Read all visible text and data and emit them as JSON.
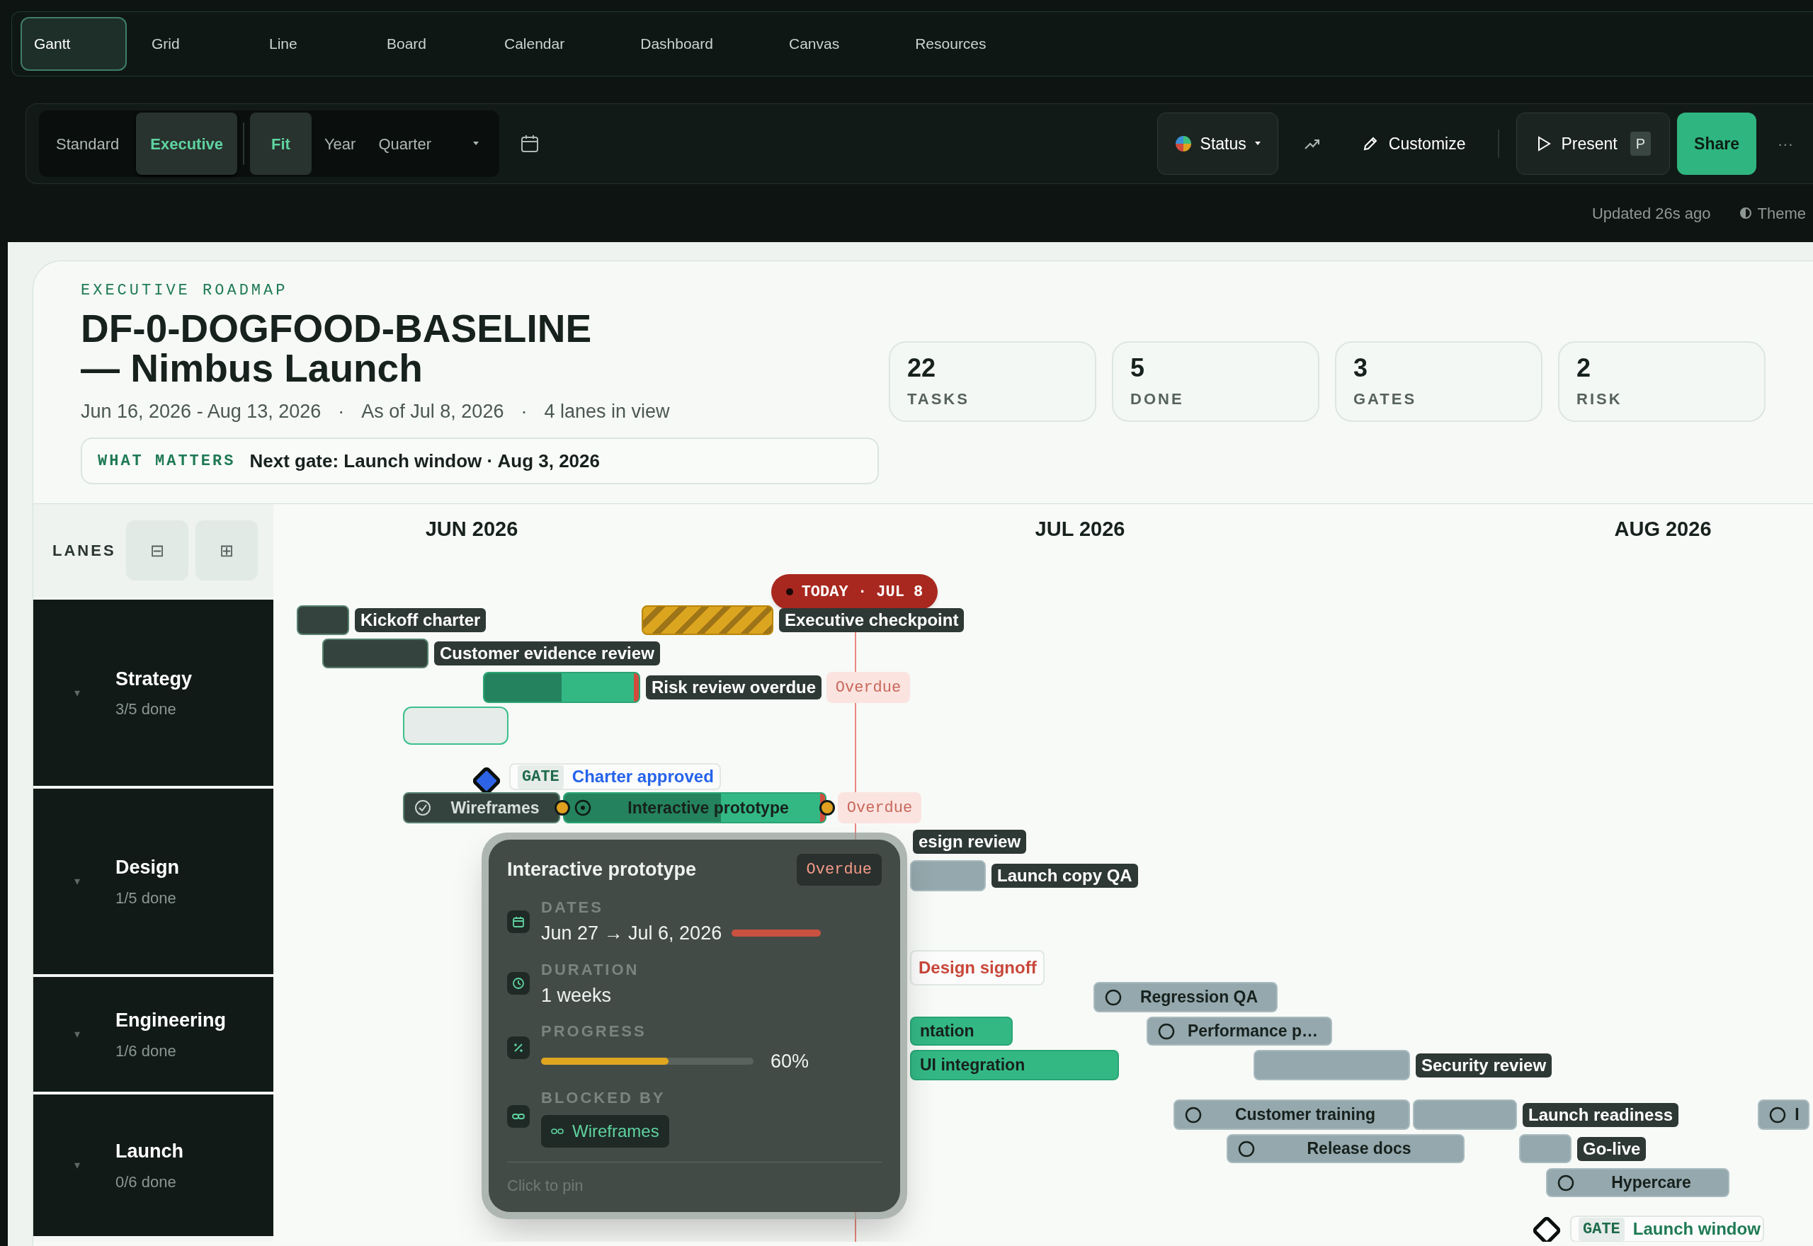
{
  "view_tabs": [
    {
      "label": "Gantt",
      "selected": true
    },
    {
      "label": "Grid",
      "selected": false
    },
    {
      "label": "Line",
      "selected": false
    },
    {
      "label": "Board",
      "selected": false
    },
    {
      "label": "Calendar",
      "selected": false
    },
    {
      "label": "Dashboard",
      "selected": false
    },
    {
      "label": "Canvas",
      "selected": false
    },
    {
      "label": "Resources",
      "selected": false
    }
  ],
  "toolbar": {
    "density": [
      {
        "label": "Standard",
        "selected": false
      },
      {
        "label": "Executive",
        "selected": true
      }
    ],
    "zoom": [
      {
        "label": "Fit",
        "selected": true
      },
      {
        "label": "Year",
        "selected": false
      },
      {
        "label": "Quarter",
        "selected": false
      }
    ],
    "status_button": "Status",
    "customize_button": "Customize",
    "present_button": {
      "label": "Present",
      "shortcut": "P"
    },
    "share_button": "Share",
    "more_button": "···"
  },
  "status_line": {
    "updated": "Updated 26s ago",
    "theme": "Theme"
  },
  "header": {
    "eyebrow": "EXECUTIVE ROADMAP",
    "title_lines": [
      "DF-0-DOGFOOD-BASELINE",
      "— Nimbus Launch"
    ],
    "meta": [
      "Jun 16, 2026 - Aug 13, 2026",
      "As of Jul 8, 2026",
      "4 lanes in view"
    ],
    "meta_separator": "·",
    "what_matters": {
      "label": "WHAT MATTERS",
      "text": "Next gate: Launch window · Aug 3, 2026"
    }
  },
  "stats": [
    {
      "value": "22",
      "label": "TASKS"
    },
    {
      "value": "5",
      "label": "DONE"
    },
    {
      "value": "3",
      "label": "GATES"
    },
    {
      "value": "2",
      "label": "RISK"
    }
  ],
  "lanes_header": {
    "title": "LANES",
    "collapse": "⊟",
    "expand": "⊞"
  },
  "lanes": [
    {
      "name": "Strategy",
      "progress": "3/5 done",
      "chevron": "▾"
    },
    {
      "name": "Design",
      "progress": "1/5 done",
      "chevron": "▾"
    },
    {
      "name": "Engineering",
      "progress": "1/6 done",
      "chevron": "▾"
    },
    {
      "name": "Launch",
      "progress": "0/6 done",
      "chevron": "▾"
    }
  ],
  "months": [
    "JUN 2026",
    "JUL 2026",
    "AUG 2026"
  ],
  "today": {
    "label": "TODAY · JUL 8"
  },
  "bars": [
    {
      "kind": "done",
      "label": "Kickoff charter"
    },
    {
      "kind": "done",
      "label": "Customer evidence review"
    },
    {
      "kind": "hatched",
      "label": "Executive checkpoint"
    },
    {
      "kind": "active",
      "label": "Risk review overdue",
      "level": 0.5,
      "overdue": true,
      "flag": "Overdue"
    },
    {
      "kind": "empty"
    },
    {
      "kind": "gate",
      "tag": "GATE",
      "label": "Charter approved",
      "color": "#2563eb"
    },
    {
      "kind": "done",
      "label": "Wireframes"
    },
    {
      "kind": "active",
      "label": "Interactive prototype",
      "level": 0.6,
      "overdue": true,
      "flag": "Overdue",
      "handles": true
    },
    {
      "kind": "label",
      "label": "esign review"
    },
    {
      "kind": "planned",
      "label": "Launch copy QA"
    },
    {
      "kind": "gate",
      "label": "Design signoff",
      "color": "#c8473a"
    },
    {
      "kind": "active",
      "label": "ntation"
    },
    {
      "kind": "active",
      "label": "UI integration"
    },
    {
      "kind": "planned",
      "label": "Regression QA"
    },
    {
      "kind": "planned",
      "label": "Performance p…"
    },
    {
      "kind": "planned",
      "label": "Security review"
    },
    {
      "kind": "planned",
      "label": "Customer training"
    },
    {
      "kind": "planned",
      "label": "Launch readiness"
    },
    {
      "kind": "planned",
      "label": "I"
    },
    {
      "kind": "planned",
      "label": "Release docs"
    },
    {
      "kind": "planned",
      "label": "Go-live"
    },
    {
      "kind": "planned",
      "label": "Hypercare"
    },
    {
      "kind": "gate",
      "tag": "GATE",
      "label": "Launch window",
      "color": "#1f7a55"
    }
  ],
  "tooltip": {
    "title": "Interactive prototype",
    "badge": "Overdue",
    "fields": [
      {
        "kind": "dates",
        "label": "DATES",
        "value": "Jun 27 → Jul 6, 2026"
      },
      {
        "kind": "duration",
        "label": "DURATION",
        "value": "1 weeks"
      },
      {
        "kind": "progress",
        "label": "PROGRESS",
        "level": 0.6,
        "reading": "60%"
      },
      {
        "kind": "blocked",
        "label": "BLOCKED BY",
        "chip": "Wireframes"
      }
    ],
    "hint": "Click to pin"
  }
}
